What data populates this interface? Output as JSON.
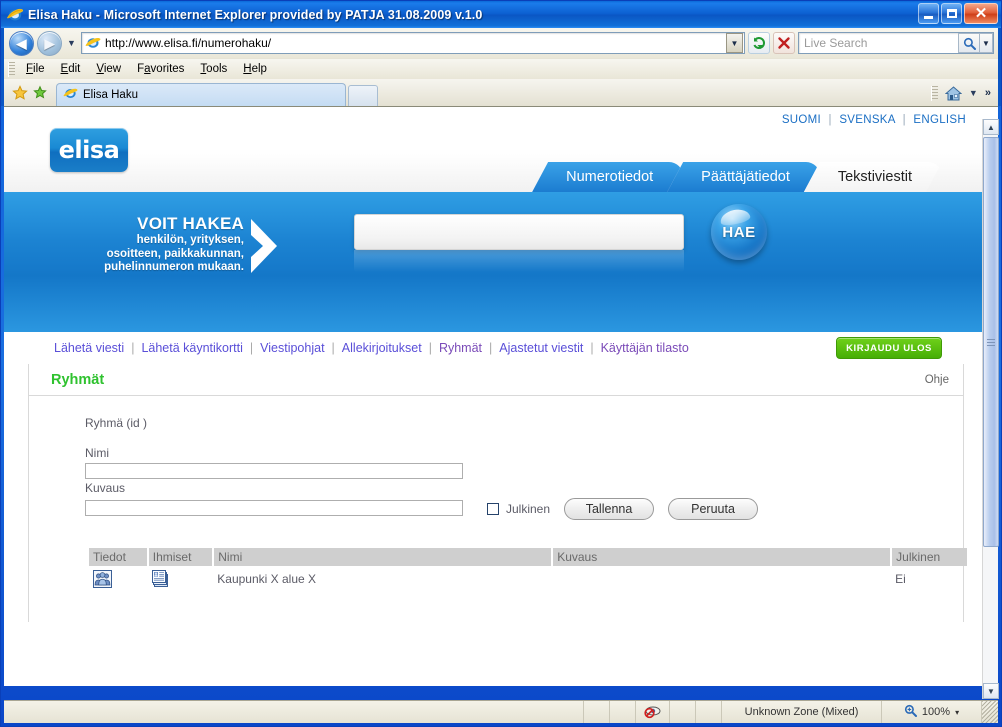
{
  "window": {
    "title": "Elisa Haku - Microsoft Internet Explorer provided by PATJA 31.08.2009 v.1.0",
    "minimize_label": "Minimize",
    "maximize_label": "Maximize",
    "close_label": "Close"
  },
  "browser": {
    "address": "http://www.elisa.fi/numerohaku/",
    "search_placeholder": "Live Search",
    "back_label": "Back",
    "forward_label": "Forward",
    "refresh_label": "Refresh",
    "stop_label": "Stop",
    "menu": [
      "File",
      "Edit",
      "View",
      "Favorites",
      "Tools",
      "Help"
    ],
    "tab_label": "Elisa Haku",
    "new_tab_label": "",
    "home_label": "Home",
    "toolbar_overflow": "»"
  },
  "statusbar": {
    "message": "",
    "zone": "Unknown Zone (Mixed)",
    "zoom": "100%",
    "zoom_caret": "▾"
  },
  "site": {
    "languages": [
      "SUOMI",
      "SVENSKA",
      "ENGLISH"
    ],
    "lang_separator": "|",
    "logo_text": "elisa",
    "tabs": [
      {
        "label": "Numerotiedot",
        "active": false
      },
      {
        "label": "Päättäjätiedot",
        "active": false
      },
      {
        "label": "Tekstiviestit",
        "active": true
      }
    ],
    "banner": {
      "headline": "VOIT HAKEA",
      "line2": "henkilön, yrityksen,",
      "line3": "osoitteen, paikkakunnan,",
      "line4": "puhelinnumeron mukaan.",
      "search_value": "",
      "search_button": "HAE"
    },
    "nav": [
      {
        "label": "Lähetä viesti",
        "visited": false
      },
      {
        "label": "Lähetä käyntikortti",
        "visited": false
      },
      {
        "label": "Viestipohjat",
        "visited": false
      },
      {
        "label": "Allekirjoitukset",
        "visited": false
      },
      {
        "label": "Ryhmät",
        "visited": true
      },
      {
        "label": "Ajastetut viestit",
        "visited": false
      },
      {
        "label": "Käyttäjän tilasto",
        "visited": true
      }
    ],
    "nav_separator": "|",
    "logout_button": "KIRJAUDU ULOS"
  },
  "panel": {
    "title": "Ryhmät",
    "help": "Ohje",
    "group_id_label": "Ryhmä (id )",
    "name_label": "Nimi",
    "name_value": "",
    "description_label": "Kuvaus",
    "description_value": "",
    "public_checkbox_label": "Julkinen",
    "public_checked": false,
    "save_button": "Tallenna",
    "cancel_button": "Peruuta"
  },
  "table": {
    "headers": [
      "Tiedot",
      "Ihmiset",
      "Nimi",
      "Kuvaus",
      "Julkinen"
    ],
    "rows": [
      {
        "info_icon": "people-group-icon",
        "people_icon": "contact-cards-icon",
        "name": "Kaupunki X alue X",
        "description": "",
        "public": "Ei"
      }
    ]
  },
  "colors": {
    "accent_blue": "#1c83d2",
    "title_green": "#2fc22f",
    "logout_green": "#46ae06",
    "link_purple": "#5a4fd8"
  }
}
